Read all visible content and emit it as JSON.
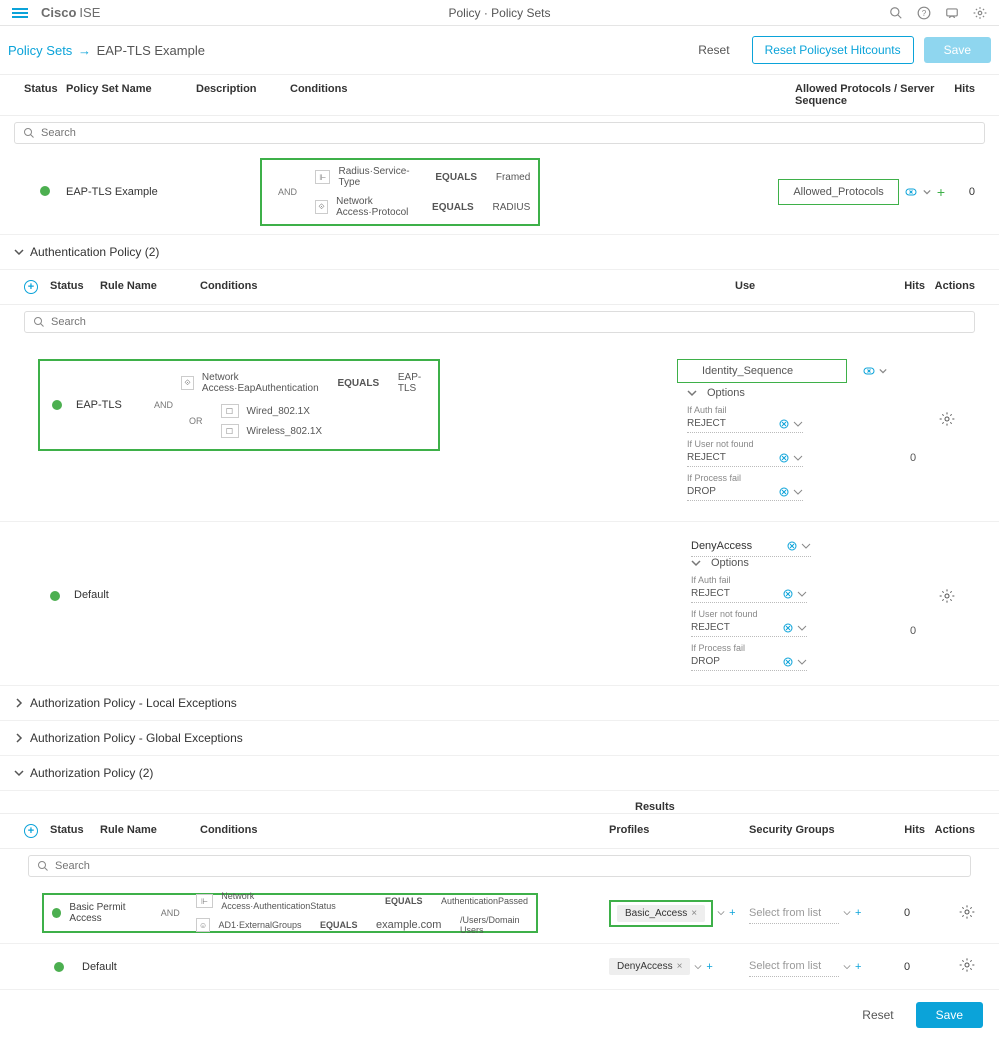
{
  "brand": {
    "name": "Cisco",
    "product": "ISE"
  },
  "breadcrumb_top": "Policy · Policy Sets",
  "breadcrumb": {
    "root": "Policy Sets",
    "current": "EAP-TLS Example"
  },
  "buttons": {
    "reset": "Reset",
    "reset_hitcount": "Reset Policyset Hitcounts",
    "save": "Save"
  },
  "main_headers": {
    "status": "Status",
    "setname": "Policy Set Name",
    "desc": "Description",
    "cond": "Conditions",
    "proto": "Allowed Protocols / Server Sequence",
    "hits": "Hits"
  },
  "search_placeholder": "Search",
  "policy_set": {
    "name": "EAP-TLS Example",
    "and": "AND",
    "cond1": {
      "l": "Radius·Service-Type",
      "op": "EQUALS",
      "r": "Framed"
    },
    "cond2": {
      "l": "Network Access·Protocol",
      "op": "EQUALS",
      "r": "RADIUS"
    },
    "proto": "Allowed_Protocols",
    "hits": "0"
  },
  "authn": {
    "title": "Authentication Policy (2)",
    "head": {
      "status": "Status",
      "rule": "Rule Name",
      "cond": "Conditions",
      "use": "Use",
      "hits": "Hits",
      "actions": "Actions"
    },
    "rule1": {
      "name": "EAP-TLS",
      "and": "AND",
      "or": "OR",
      "cond_main": {
        "l": "Network Access·EapAuthentication",
        "op": "EQUALS",
        "r": "EAP-TLS"
      },
      "cond_sub1": "Wired_802.1X",
      "cond_sub2": "Wireless_802.1X",
      "use": "Identity_Sequence",
      "hits": "0"
    },
    "rule2": {
      "name": "Default",
      "use": "DenyAccess",
      "hits": "0"
    },
    "options_label": "Options",
    "opt": {
      "auth_fail": "If Auth fail",
      "reject": "REJECT",
      "user_nf": "If User not found",
      "process_fail": "If Process fail",
      "drop": "DROP"
    }
  },
  "authz_sections": {
    "local": "Authorization Policy - Local Exceptions",
    "global": "Authorization Policy - Global Exceptions",
    "main": "Authorization Policy (2)"
  },
  "authz": {
    "results": "Results",
    "head": {
      "status": "Status",
      "rule": "Rule Name",
      "cond": "Conditions",
      "profiles": "Profiles",
      "sec": "Security Groups",
      "hits": "Hits",
      "actions": "Actions"
    },
    "rule1": {
      "name": "Basic Permit Access",
      "and": "AND",
      "cond1": {
        "l": "Network Access·AuthenticationStatus",
        "op": "EQUALS",
        "r": "AuthenticationPassed"
      },
      "cond2": {
        "l": "AD1·ExternalGroups",
        "op": "EQUALS",
        "r1": "example.com",
        "r2": "/Users/Domain Users"
      },
      "profile": "Basic_Access",
      "sec_ph": "Select from list",
      "hits": "0"
    },
    "rule2": {
      "name": "Default",
      "profile": "DenyAccess",
      "sec_ph": "Select from list",
      "hits": "0"
    }
  }
}
